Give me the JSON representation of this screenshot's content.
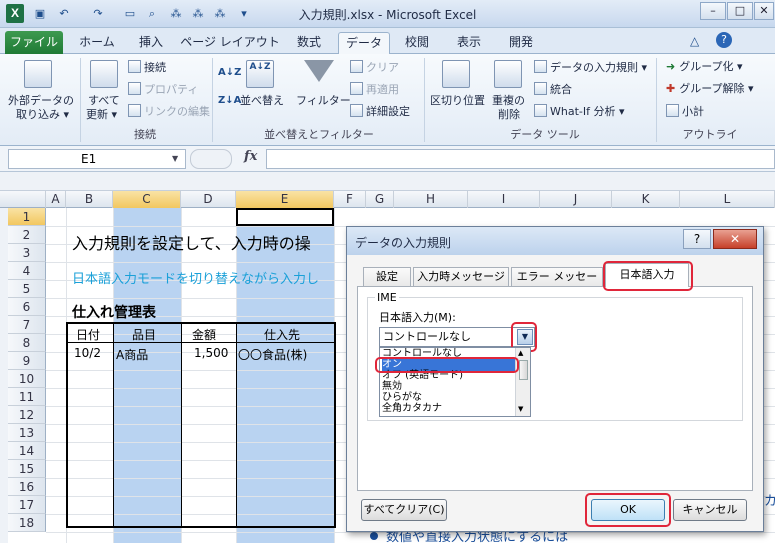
{
  "window": {
    "title": "入力規則.xlsx - Microsoft Excel",
    "logo": "X",
    "min": "–",
    "max": "□",
    "close": "✕"
  },
  "ribbon_tabs": [
    "ファイル",
    "ホーム",
    "挿入",
    "ページ レイアウト",
    "数式",
    "データ",
    "校閲",
    "表示",
    "開発"
  ],
  "ribbon": {
    "ext_data": [
      "外部データの",
      "取り込み ▾"
    ],
    "refresh_all": [
      "すべて",
      "更新 ▾"
    ],
    "connections": "接続",
    "properties": "プロパティ",
    "edit_links": "リンクの編集",
    "group_connections": "接続",
    "sort_az": "A↓Z",
    "sort": "並べ替え",
    "filter": "フィルター",
    "clear": "クリア",
    "reapply": "再適用",
    "advanced": "詳細設定",
    "group_sort": "並べ替えとフィルター",
    "text_to_columns": "区切り位置",
    "remove_dup": [
      "重複の",
      "削除"
    ],
    "data_validation": "データの入力規則 ▾",
    "consolidate": "統合",
    "whatif": "What-If 分析 ▾",
    "group_tools": "データ ツール",
    "group_btn": "グループ化 ▾",
    "ungroup_btn": "グループ解除 ▾",
    "subtotal": "小計",
    "group_outline": "アウトライン"
  },
  "formula_bar": {
    "name_box": "E1",
    "fx": "fx"
  },
  "sheet": {
    "columns": [
      "A",
      "B",
      "C",
      "D",
      "E",
      "F",
      "G",
      "H",
      "I",
      "J",
      "K",
      "L"
    ],
    "rows": [
      "1",
      "2",
      "3",
      "4",
      "5",
      "6",
      "7",
      "8",
      "9",
      "10",
      "11",
      "12",
      "13",
      "14",
      "15",
      "16",
      "17",
      "18"
    ],
    "heading": "入力規則を設定して、入力時の操",
    "subheading": "日本語入力モードを切り替えながら入力し",
    "table_title": "仕入れ管理表",
    "table_headers": [
      "日付",
      "品目",
      "金額",
      "仕入先"
    ],
    "row8": [
      "10/2",
      "A商品",
      "1,500",
      "〇〇食品(株)"
    ],
    "behind_text": "数値や直接入力状態にするには",
    "behind_fragment": "カ"
  },
  "dialog": {
    "title": "データの入力規則",
    "help": "?",
    "close": "✕",
    "tabs": [
      "設定",
      "入力時メッセージ",
      "エラー メッセージ",
      "日本語入力"
    ],
    "group_label": "IME",
    "field_label": "日本語入力(M):",
    "combo_value": "コントロールなし",
    "options": [
      "コントロールなし",
      "オン",
      "オフ (英語モード)",
      "無効",
      "ひらがな",
      "全角カタカナ"
    ],
    "selected_option": "オン",
    "clear_all": "すべてクリア(C)",
    "ok": "OK",
    "cancel": "キャンセル"
  },
  "colors": {
    "accent_red": "#e0263a",
    "selection_blue": "#b9d3f1",
    "excel_green": "#1e7145"
  }
}
